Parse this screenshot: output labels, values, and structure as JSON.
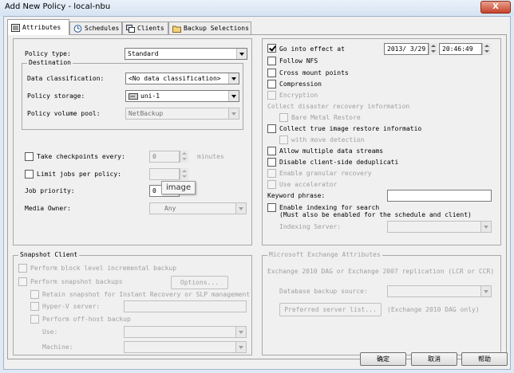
{
  "window": {
    "title": "Add New Policy - local-nbu",
    "close_label": "X"
  },
  "tabs": [
    {
      "label": "Attributes",
      "icon": "attributes-icon"
    },
    {
      "label": "Schedules",
      "icon": "schedules-icon"
    },
    {
      "label": "Clients",
      "icon": "clients-icon"
    },
    {
      "label": "Backup Selections",
      "icon": "folder-icon"
    }
  ],
  "left": {
    "policy_type_label": "Policy type:",
    "policy_type_value": "Standard",
    "destination_title": "Destination",
    "data_class_label": "Data classification:",
    "data_class_value": "<No data classification>",
    "policy_storage_label": "Policy storage:",
    "policy_storage_value": "uni-1",
    "policy_volume_pool_label": "Policy volume pool:",
    "policy_volume_pool_value": "NetBackup",
    "take_checkpoints_label": "Take checkpoints every:",
    "take_checkpoints_value": "0",
    "minutes_label": "minutes",
    "limit_jobs_label": "Limit jobs per policy:",
    "job_priority_label": "Job priority:",
    "job_priority_value": "0",
    "tooltip": "image",
    "media_owner_label": "Media Owner:",
    "media_owner_value": "Any"
  },
  "right": {
    "go_into_effect_label": "Go into effect at",
    "date_value": "2013/ 3/29",
    "time_value": "20:46:49",
    "follow_nfs": "Follow NFS",
    "cross_mount_points": "Cross mount points",
    "compression": "Compression",
    "encryption": "Encryption",
    "collect_dr_info": "Collect disaster recovery information",
    "bare_metal_restore": "Bare Metal Restore",
    "collect_tir": "Collect true image restore informatio",
    "with_move_detection": "with move detection",
    "allow_multiple_streams": "Allow multiple data streams",
    "disable_dedup": "Disable client-side deduplicati",
    "enable_granular": "Enable granular recovery",
    "use_accelerator": "Use accelerator",
    "keyword_phrase_label": "Keyword phrase:",
    "enable_indexing": "Enable indexing for search",
    "indexing_note": "(Must also be enabled for the schedule and client)",
    "indexing_server_label": "Indexing Server:"
  },
  "snapshot": {
    "title": "Snapshot Client",
    "block_level": "Perform block level incremental backup",
    "snapshot_backups": "Perform snapshot backups",
    "options_button": "Options...",
    "retain_snapshot": "Retain snapshot for Instant Recovery or SLP management",
    "hyperv_server": "Hyper-V server:",
    "offhost_backup": "Perform off-host backup",
    "use_label": "Use:",
    "machine_label": "Machine:"
  },
  "exchange": {
    "title": "Microsoft Exchange Attributes",
    "replication_text": "Exchange 2010 DAG or Exchange 2007 replication (LCR or CCR)",
    "db_backup_source_label": "Database backup source:",
    "preferred_server_button": "Preferred server list...",
    "exchange_only": "(Exchange 2010 DAG only)"
  },
  "footer": {
    "ok": "确定",
    "cancel": "取消",
    "help": "帮助"
  }
}
